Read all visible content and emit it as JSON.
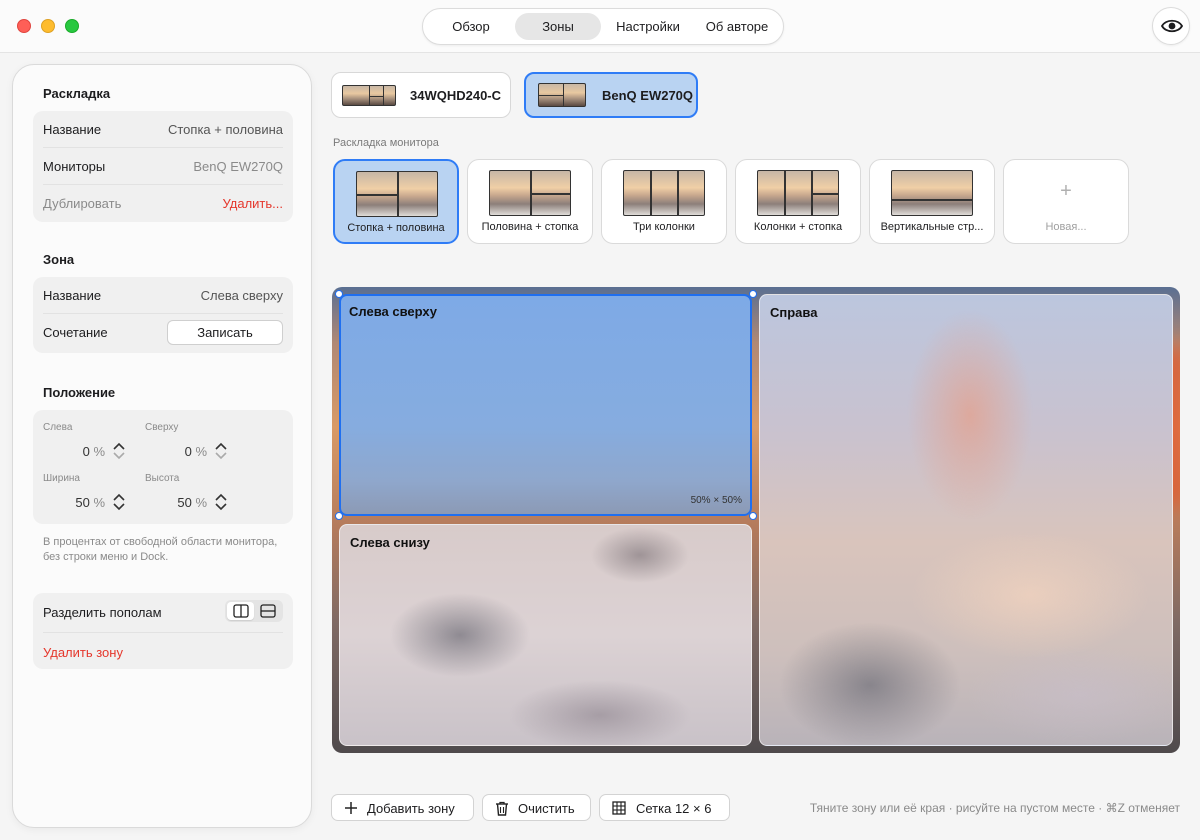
{
  "tabs": [
    {
      "label": "Обзор",
      "active": false
    },
    {
      "label": "Зоны",
      "active": true
    },
    {
      "label": "Настройки",
      "active": false
    },
    {
      "label": "Об авторе",
      "active": false
    }
  ],
  "toolbar": {
    "eye_icon": "eye-icon"
  },
  "sidebar": {
    "layout": {
      "title": "Раскладка",
      "name_label": "Название",
      "name_value": "Стопка + половина",
      "monitors_label": "Мониторы",
      "monitors_value": "BenQ EW270Q",
      "duplicate_label": "Дублировать",
      "delete_label": "Удалить..."
    },
    "zone": {
      "title": "Зона",
      "name_label": "Название",
      "name_value": "Слева сверху",
      "shortcut_label": "Сочетание",
      "record_label": "Записать"
    },
    "position": {
      "title": "Положение",
      "left_label": "Слева",
      "left_value": "0",
      "top_label": "Сверху",
      "top_value": "0",
      "width_label": "Ширина",
      "width_value": "50",
      "height_label": "Высота",
      "height_value": "50",
      "unit": "%",
      "hint": "В процентах от свободной области монитора, без строки меню и Dock."
    },
    "actions": {
      "split_label": "Разделить пополам",
      "delete_zone_label": "Удалить зону"
    }
  },
  "monitors": [
    {
      "name": "34WQHD240-C",
      "selected": false
    },
    {
      "name": "BenQ EW270Q",
      "selected": true
    }
  ],
  "layouts_label": "Раскладка монитора",
  "layouts": [
    {
      "name": "Стопка + половина",
      "selected": true
    },
    {
      "name": "Половина + стопка",
      "selected": false
    },
    {
      "name": "Три колонки",
      "selected": false
    },
    {
      "name": "Колонки + стопка",
      "selected": false
    },
    {
      "name": "Вертикальные стр...",
      "selected": false
    },
    {
      "name": "Новая...",
      "selected": false
    }
  ],
  "zones": [
    {
      "name": "Слева сверху",
      "size": "50% × 50%",
      "selected": true
    },
    {
      "name": "Справа",
      "selected": false
    },
    {
      "name": "Слева снизу",
      "selected": false
    }
  ],
  "bottom": {
    "add_zone": "Добавить зону",
    "clear": "Очистить",
    "grid": "Сетка 12 × 6",
    "hint": "Тяните зону или её края · рисуйте на пустом месте · ⌘Z отменяет"
  },
  "colors": {
    "accent": "#2f7cf6",
    "destructive": "#e5372c",
    "selected_fill": "#b9d3f2"
  }
}
